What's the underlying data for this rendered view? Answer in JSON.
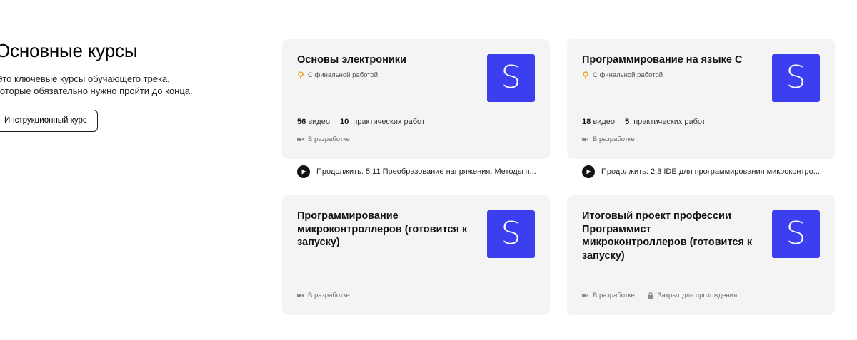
{
  "intro": {
    "title": "Основные курсы",
    "description_line1": "Это ключевые курсы обучающего трека,",
    "description_line2": "которые обязательно нужно пройти до конца.",
    "button_label": "Инструкционный курс"
  },
  "courses": [
    {
      "title": "Основы электроники",
      "final_label": "С финальной работой",
      "logo_letter": "S",
      "videos_count": "56",
      "videos_label": "видео",
      "practice_count": "10",
      "practice_label": "практических работ",
      "status": "В разработке",
      "continue_text": "Продолжить: 5.11 Преобразование напряжения. Методы п..."
    },
    {
      "title": "Программирование на языке С",
      "final_label": "С финальной работой",
      "logo_letter": "S",
      "videos_count": "18",
      "videos_label": "видео",
      "practice_count": "5",
      "practice_label": "практических работ",
      "status": "В разработке",
      "continue_text": "Продолжить: 2.3 IDE для программирования микроконтро..."
    },
    {
      "title": "Программирование микроконтроллеров (готовится к запуску)",
      "logo_letter": "S",
      "status": "В разработке"
    },
    {
      "title": "Итоговый проект профессии Программист микроконтроллеров (готовится к запуску)",
      "logo_letter": "S",
      "status": "В разработке",
      "lock_label": "Закрыт для прохождения"
    }
  ],
  "colors": {
    "brand": "#3c3ff0",
    "card_bg": "#f4f4f4",
    "pin": "#f0a020"
  }
}
